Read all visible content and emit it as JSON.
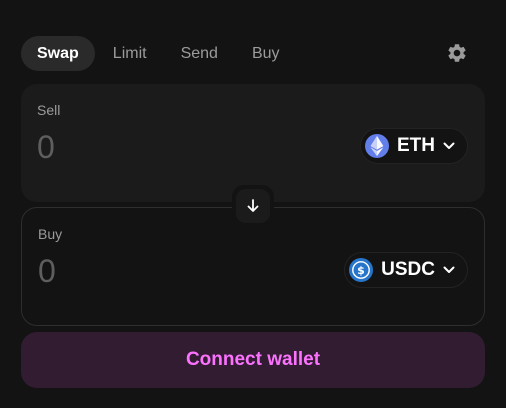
{
  "tabs": [
    {
      "label": "Swap",
      "active": true
    },
    {
      "label": "Limit",
      "active": false
    },
    {
      "label": "Send",
      "active": false
    },
    {
      "label": "Buy",
      "active": false
    }
  ],
  "settings": {
    "icon": "gear-icon"
  },
  "sell": {
    "label": "Sell",
    "amount": "0",
    "token": {
      "symbol": "ETH",
      "icon": "eth-icon",
      "color": "#627eea"
    }
  },
  "switch": {
    "icon": "arrow-down-icon"
  },
  "buy": {
    "label": "Buy",
    "amount": "0",
    "token": {
      "symbol": "USDC",
      "icon": "usdc-icon",
      "color": "#2775ca"
    }
  },
  "connect": {
    "label": "Connect wallet",
    "color": "#fc72ff",
    "background": "#311c31"
  }
}
